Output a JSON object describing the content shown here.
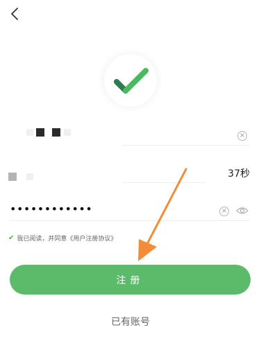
{
  "header": {
    "back_icon": "chevron-left-icon"
  },
  "logo": {
    "icon": "checkmark-icon",
    "accent": "#3a9a5b"
  },
  "phone_field": {
    "clear_icon": "clear-circle-icon"
  },
  "code_field": {
    "countdown": "37秒"
  },
  "password_field": {
    "value": "••••••••••••",
    "clear_icon": "clear-circle-icon",
    "eye_icon": "eye-icon"
  },
  "agreement": {
    "text": "我已阅读，并同意《用户注册协议》",
    "checked": true
  },
  "register_button": {
    "label": "注册",
    "color": "#5cbb6b"
  },
  "have_account": {
    "label": "已有账号"
  },
  "annotation": {
    "arrow_color": "#f28c38"
  }
}
